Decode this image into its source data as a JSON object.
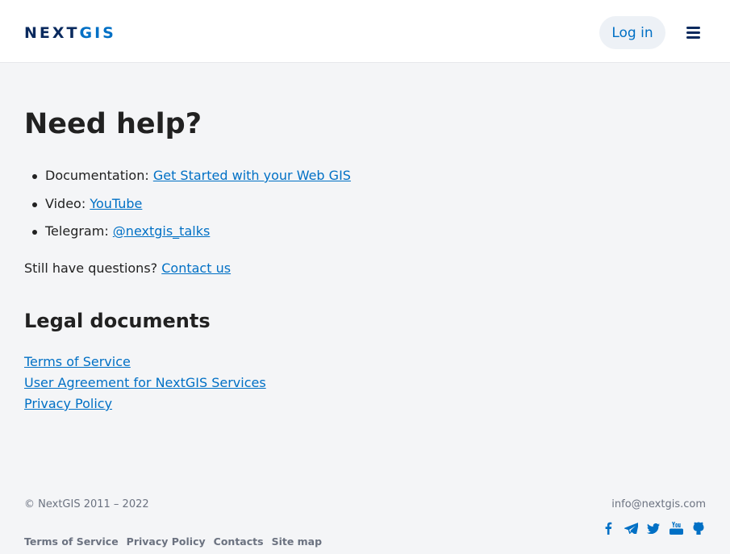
{
  "header": {
    "logo_text_part1": "N",
    "logo_text_part2": "E",
    "logo_text_part3": "XT",
    "logo_text_part4": "GIS",
    "login_label": "Log in"
  },
  "help": {
    "title": "Need help?",
    "items": [
      {
        "label": "Documentation:",
        "link": "Get Started with your Web GIS"
      },
      {
        "label": "Video:",
        "link": "YouTube"
      },
      {
        "label": "Telegram:",
        "link": "@nextgis_talks"
      }
    ],
    "still_text": "Still have questions?",
    "contact_link": "Contact us"
  },
  "legal": {
    "title": "Legal documents",
    "links": [
      "Terms of Service",
      "User Agreement for NextGIS Services",
      "Privacy Policy"
    ]
  },
  "footer": {
    "copyright": "© NextGIS 2011 – 2022",
    "email": "info@nextgis.com",
    "links": [
      "Terms of Service",
      "Privacy Policy",
      "Contacts",
      "Site map"
    ],
    "socials": [
      "facebook-icon",
      "telegram-icon",
      "twitter-icon",
      "youtube-icon",
      "github-icon"
    ]
  },
  "colors": {
    "accent": "#0070c5",
    "logo_dark": "#0a2a5e",
    "text": "#212121",
    "muted": "#6b7280"
  }
}
